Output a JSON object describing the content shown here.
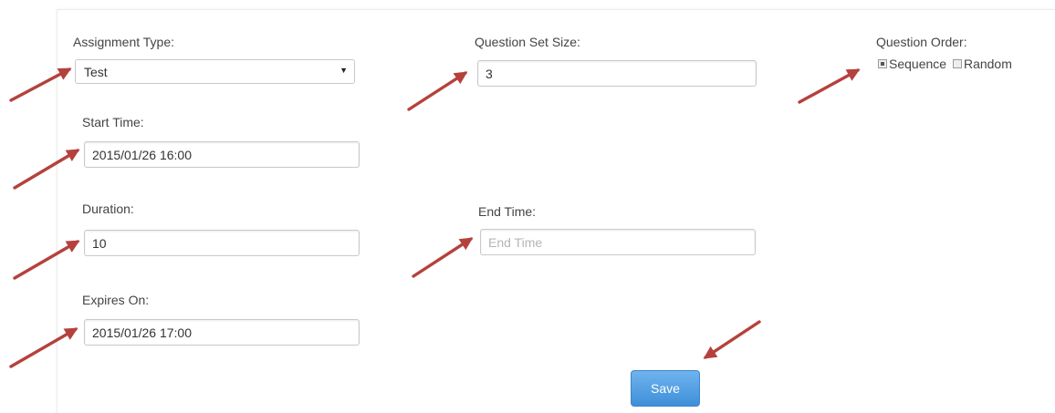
{
  "form": {
    "assignment_type": {
      "label": "Assignment Type:",
      "selected": "Test"
    },
    "question_set_size": {
      "label": "Question Set Size:",
      "value": "3"
    },
    "question_order": {
      "label": "Question Order:",
      "options": [
        {
          "label": "Sequence",
          "checked": true
        },
        {
          "label": "Random",
          "checked": false
        }
      ]
    },
    "start_time": {
      "label": "Start Time:",
      "value": "2015/01/26 16:00"
    },
    "duration": {
      "label": "Duration:",
      "value": "10"
    },
    "end_time": {
      "label": "End Time:",
      "value": "",
      "placeholder": "End Time"
    },
    "expires_on": {
      "label": "Expires On:",
      "value": "2015/01/26 17:00"
    },
    "save_label": "Save"
  },
  "colors": {
    "annotation_arrow": "#b5413c",
    "button_blue": "#4a97dd"
  }
}
